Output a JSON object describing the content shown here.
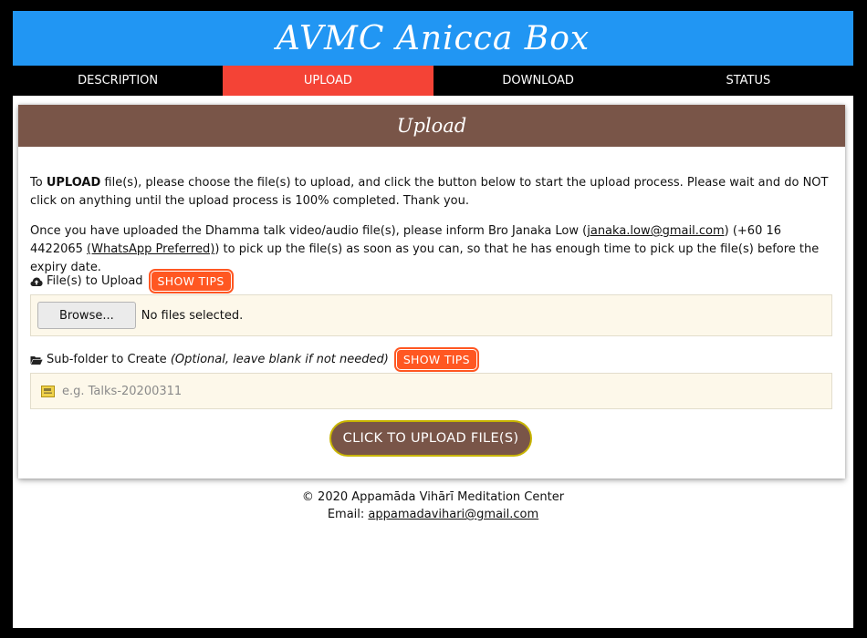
{
  "header": {
    "title": "AVMC Anicca Box"
  },
  "nav": {
    "tabs": [
      {
        "label": "DESCRIPTION",
        "active": false
      },
      {
        "label": "UPLOAD",
        "active": true
      },
      {
        "label": "DOWNLOAD",
        "active": false
      },
      {
        "label": "STATUS",
        "active": false
      }
    ]
  },
  "card": {
    "title": "Upload",
    "para1": {
      "pre": "To ",
      "bold": "UPLOAD",
      "post": " file(s), please choose the file(s) to upload, and click the button below to start the upload process. Please wait and do NOT click on anything until the upload process is 100% completed. Thank you."
    },
    "para2": {
      "pre": "Once you have uploaded the Dhamma talk video/audio file(s), please inform Bro Janaka Low (",
      "email_link": "janaka.low@gmail.com",
      "mid": ") (+60 16 4422065 ",
      "whatsapp_link": "(WhatsApp Preferred)",
      "post": ") to pick up the file(s) as soon as you can, so that he has enough time to pick up the file(s) before the expiry date."
    },
    "files": {
      "label": "File(s) to Upload",
      "tips_label": "SHOW TIPS",
      "browse_label": "Browse...",
      "status": "No files selected."
    },
    "folder": {
      "label": "Sub-folder to Create ",
      "hint": "(Optional, leave blank if not needed)",
      "tips_label": "SHOW TIPS",
      "placeholder": "e.g. Talks-20200311"
    },
    "upload_button": "CLICK TO UPLOAD FILE(S)"
  },
  "footer": {
    "copyright": "© 2020 Appamāda Vihārī Meditation Center",
    "email_label": "Email: ",
    "email": "appamadavihari@gmail.com"
  },
  "colors": {
    "header": "#2196f3",
    "active_tab": "#f44336",
    "card_header": "#795548",
    "tips": "#ff5722",
    "box_bg": "#fdf8ea"
  }
}
